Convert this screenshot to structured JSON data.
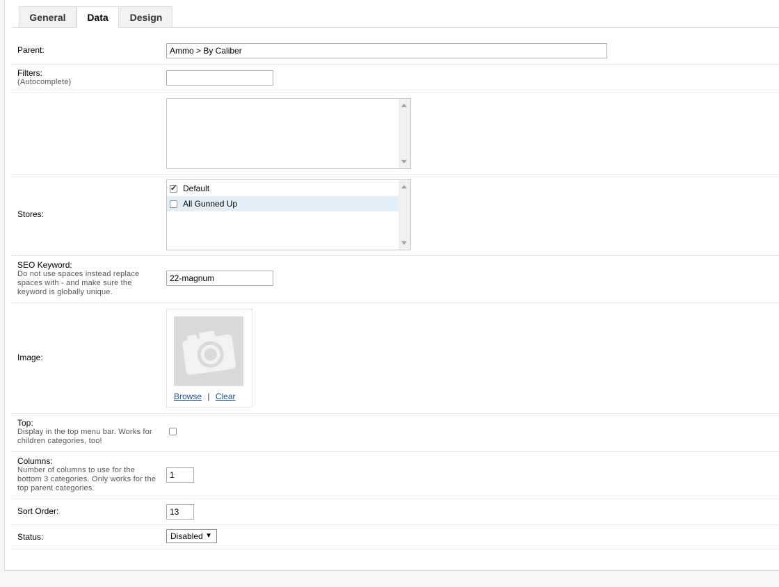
{
  "tabs": [
    "General",
    "Data",
    "Design"
  ],
  "fields": {
    "parent": {
      "label": "Parent:",
      "value": "Ammo > By Caliber"
    },
    "filters": {
      "label": "Filters:",
      "help": "(Autocomplete)",
      "value": ""
    },
    "stores": {
      "label": "Stores:",
      "items": [
        {
          "label": "Default",
          "checked": true
        },
        {
          "label": "All Gunned Up",
          "checked": false
        }
      ]
    },
    "seo_keyword": {
      "label": "SEO Keyword:",
      "help": "Do not use spaces instead replace spaces with - and make sure the keyword is globally unique.",
      "value": "22-magnum"
    },
    "image": {
      "label": "Image:",
      "browse": "Browse",
      "separator": "|",
      "clear": "Clear"
    },
    "top": {
      "label": "Top:",
      "help": "Display in the top menu bar. Works for children categories, too!",
      "checked": false
    },
    "columns": {
      "label": "Columns:",
      "help": "Number of columns to use for the bottom 3 categories. Only works for the top parent categories.",
      "value": "1"
    },
    "sort_order": {
      "label": "Sort Order:",
      "value": "13"
    },
    "status": {
      "label": "Status:",
      "value": "Disabled"
    }
  },
  "icons": {
    "image_placeholder": "camera-icon",
    "dropdown": "caret-down-icon",
    "checkmark": "checkmark-icon"
  }
}
